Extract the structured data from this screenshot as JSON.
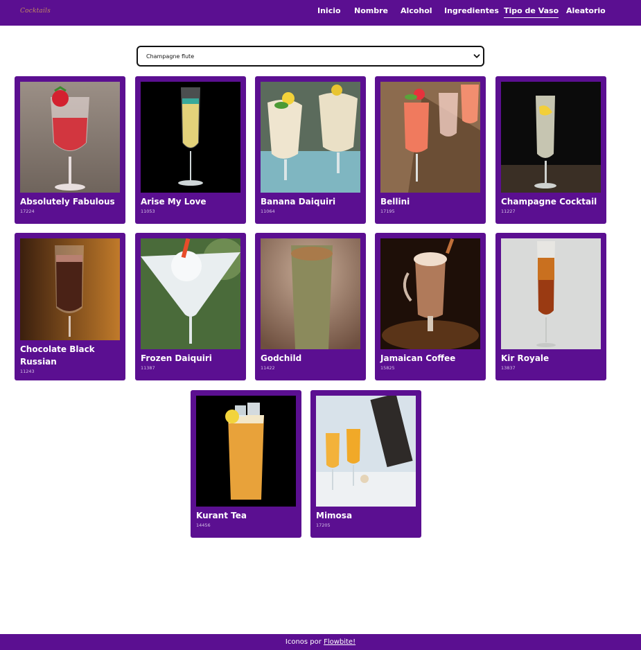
{
  "navbar": {
    "logo_text": "Cocktails",
    "items": [
      {
        "label": "Inicio",
        "active": false
      },
      {
        "label": "Nombre",
        "active": false
      },
      {
        "label": "Alcohol",
        "active": false
      },
      {
        "label": "Ingredientes",
        "active": false
      },
      {
        "label": "Tipo de Vaso",
        "active": true
      },
      {
        "label": "Aleatorio",
        "active": false
      }
    ]
  },
  "glass_select": {
    "selected": "Champagne flute"
  },
  "drinks": [
    {
      "name": "Absolutely Fabulous",
      "id": "17224"
    },
    {
      "name": "Arise My Love",
      "id": "11053"
    },
    {
      "name": "Banana Daiquiri",
      "id": "11064"
    },
    {
      "name": "Bellini",
      "id": "17195"
    },
    {
      "name": "Champagne Cocktail",
      "id": "11227"
    },
    {
      "name": "Chocolate Black Russian",
      "id": "11243"
    },
    {
      "name": "Frozen Daiquiri",
      "id": "11387"
    },
    {
      "name": "Godchild",
      "id": "11422"
    },
    {
      "name": "Jamaican Coffee",
      "id": "15825"
    },
    {
      "name": "Kir Royale",
      "id": "13837"
    },
    {
      "name": "Kurant Tea",
      "id": "14456"
    },
    {
      "name": "Mimosa",
      "id": "17205"
    }
  ],
  "footer": {
    "text": "Iconos por ",
    "link_label": "Flowbite!"
  },
  "colors": {
    "brand_purple": "#5b0f91",
    "background": "#ffffff"
  }
}
